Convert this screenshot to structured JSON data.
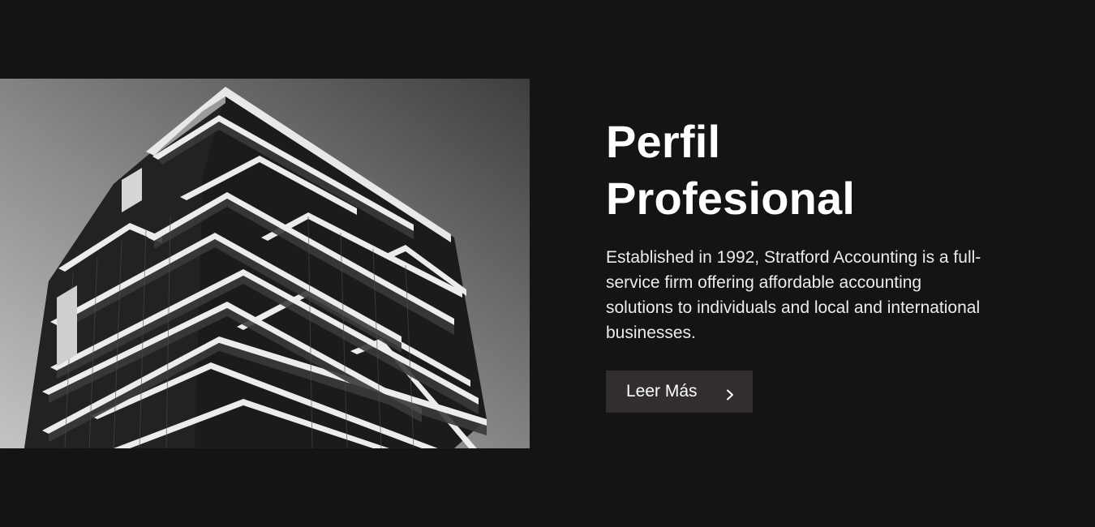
{
  "hero": {
    "image_alt": "Black and white photo of a modern high-rise building with cantilevered balconies",
    "title_line1": "Perfil",
    "title_line2": "Profesional",
    "description": "Established in 1992, Stratford Accounting is a full-service firm offering affordable accounting solutions to individuals and local and international businesses.",
    "button_label": "Leer Más",
    "button_icon": "chevron-right-icon"
  },
  "colors": {
    "background": "#141414",
    "button_background": "#312e2d",
    "title": "#ffffff",
    "text": "#ececec"
  }
}
